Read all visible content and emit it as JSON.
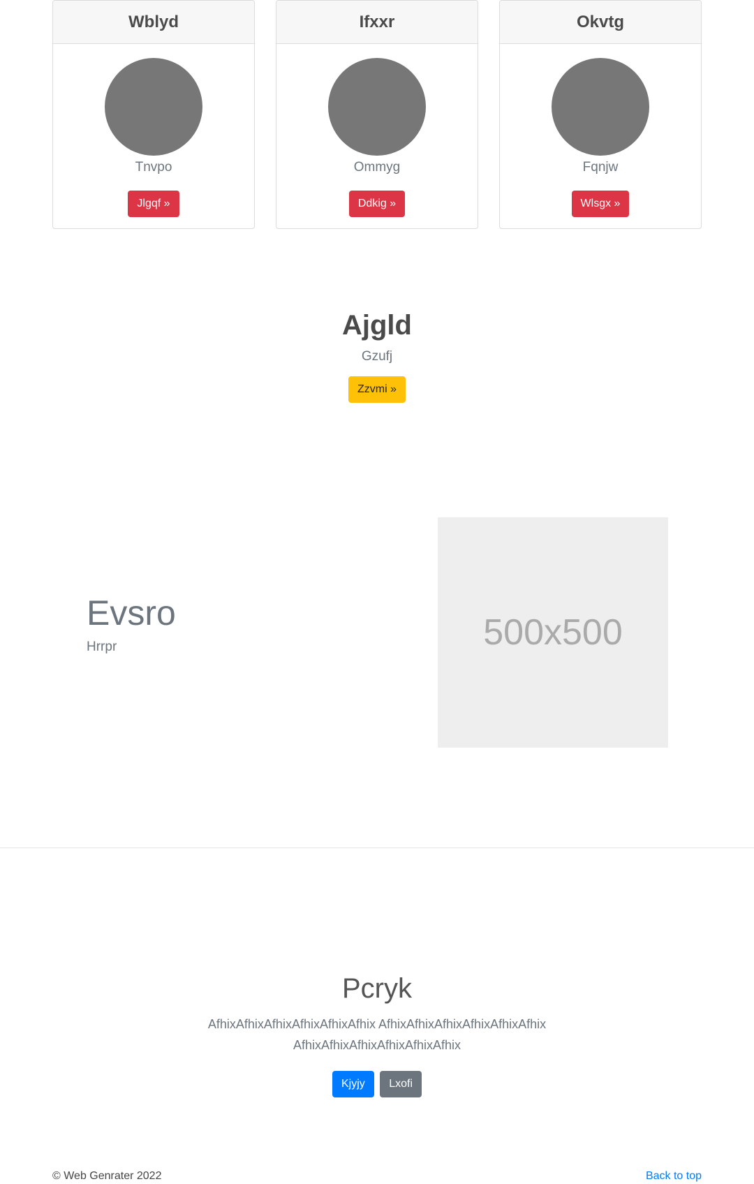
{
  "cards": [
    {
      "title": "Wblyd",
      "subtitle": "Tnvpo",
      "button": "Jlgqf »"
    },
    {
      "title": "Ifxxr",
      "subtitle": "Ommyg",
      "button": "Ddkig »"
    },
    {
      "title": "Okvtg",
      "subtitle": "Fqnjw",
      "button": "Wlsgx »"
    }
  ],
  "hero": {
    "title": "Ajgld",
    "subtitle": "Gzufj",
    "button": "Zzvmi »"
  },
  "feature": {
    "title": "Evsro",
    "subtitle": "Hrrpr",
    "image_placeholder": "500x500"
  },
  "lower": {
    "title": "Pcryk",
    "text": "AfhixAfhixAfhixAfhixAfhixAfhix AfhixAfhixAfhixAfhixAfhixAfhix AfhixAfhixAfhixAfhixAfhixAfhix",
    "primary_button": "Kjyjy",
    "secondary_button": "Lxofi"
  },
  "footer": {
    "copyright": "© Web Genrater 2022",
    "back_to_top": "Back to top"
  },
  "colors": {
    "danger": "#dc3545",
    "warning": "#ffc107",
    "primary": "#007bff",
    "secondary": "#6c757d",
    "avatar": "#777777"
  }
}
